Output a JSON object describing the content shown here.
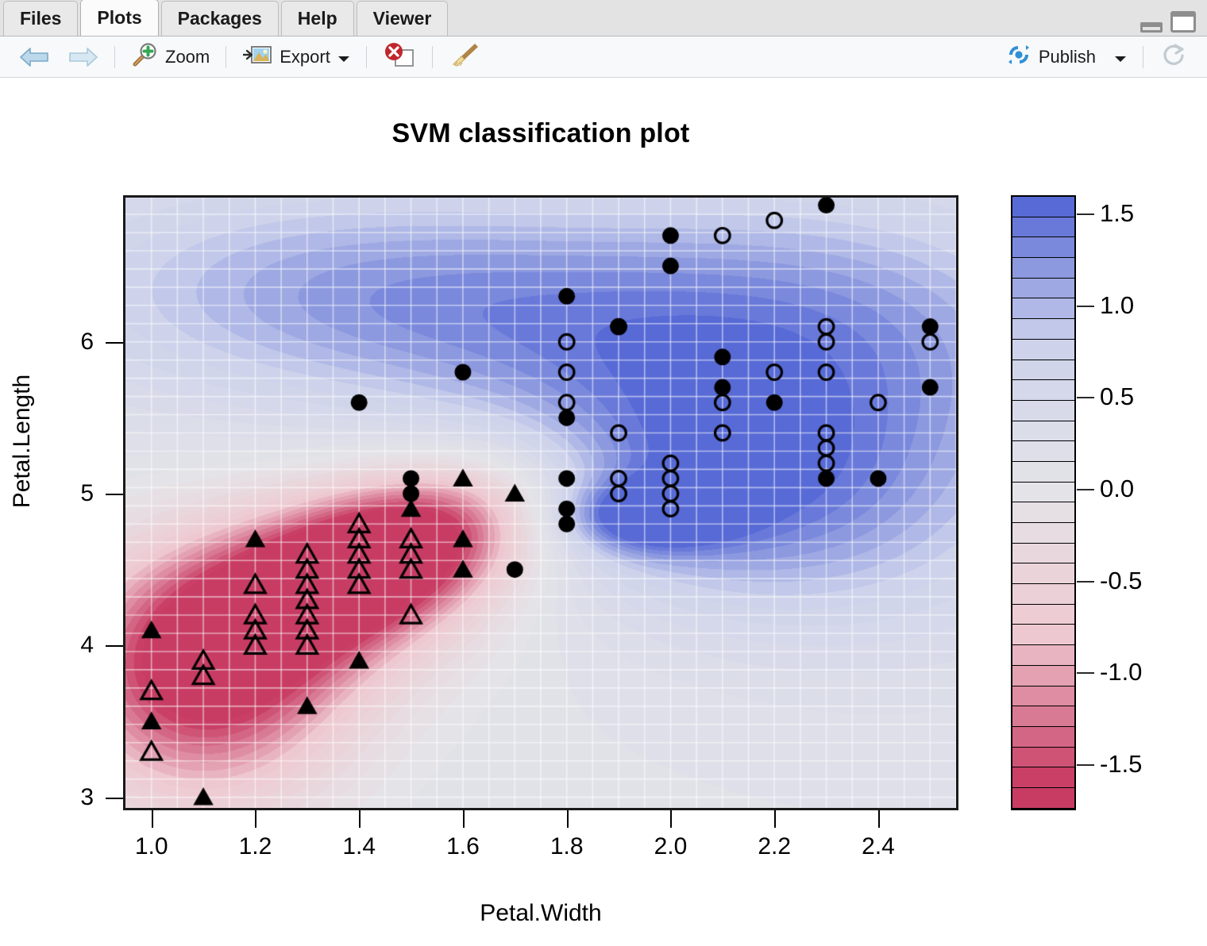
{
  "tabs": [
    {
      "label": "Files"
    },
    {
      "label": "Plots"
    },
    {
      "label": "Packages"
    },
    {
      "label": "Help"
    },
    {
      "label": "Viewer"
    }
  ],
  "active_tab": "Plots",
  "toolbar": {
    "zoom_label": "Zoom",
    "export_label": "Export",
    "publish_label": "Publish",
    "icons": [
      "arrow-left-icon",
      "arrow-right-icon",
      "zoom-icon",
      "export-icon",
      "chevron-down-icon",
      "remove-plot-icon",
      "broom-icon",
      "publish-icon",
      "refresh-icon"
    ]
  },
  "window_controls": {
    "minimize": "minimize-icon",
    "maximize": "maximize-icon"
  },
  "chart_data": {
    "type": "scatter",
    "title": "SVM classification plot",
    "xlabel": "Petal.Width",
    "ylabel": "Petal.Length",
    "xlim": [
      0.95,
      2.55
    ],
    "ylim": [
      2.93,
      6.95
    ],
    "xticks": [
      1.0,
      1.2,
      1.4,
      1.6,
      1.8,
      2.0,
      2.2,
      2.4
    ],
    "xticklabels": [
      "1.0",
      "1.2",
      "1.4",
      "1.6",
      "1.8",
      "2.0",
      "2.2",
      "2.4"
    ],
    "yticks": [
      3,
      4,
      5,
      6
    ],
    "yticklabels": [
      "3",
      "4",
      "5",
      "6"
    ],
    "grid": true,
    "legend": {
      "position": "right",
      "orientation": "vertical",
      "ticks": [
        1.5,
        1.0,
        0.5,
        0.0,
        -0.5,
        -1.0,
        -1.5
      ],
      "ticklabels": [
        "1.5",
        "1.0",
        "0.5",
        "0.0",
        "-0.5",
        "-1.0",
        "-1.5"
      ],
      "range": [
        -1.75,
        1.6
      ],
      "n_bands": 30,
      "colors": {
        "high": "#5c73d4",
        "mid": "#e2e2e6",
        "low": "#c8476f"
      }
    },
    "surface": {
      "description": "SVM decision value contour field: red/negative lobe lower-left, blue/positive lobe upper-right with deep blue core near (1.95, 4.85)",
      "red_peak": {
        "x": 1.46,
        "y": 4.62,
        "value": -1.6
      },
      "red_peak_secondary": {
        "x": 1.1,
        "y": 3.75,
        "value": -1.15
      },
      "blue_peak": {
        "x": 1.95,
        "y": 4.85,
        "value": 1.45
      },
      "blue_ridge": {
        "x": 1.55,
        "y": 6.25,
        "value": 0.9
      }
    },
    "series": [
      {
        "name": "versicolor (filled triangle = support vector)",
        "marker": "filled-triangle",
        "points": [
          [
            1.0,
            4.1
          ],
          [
            1.0,
            3.5
          ],
          [
            1.1,
            3.0
          ],
          [
            1.2,
            4.7
          ],
          [
            1.3,
            3.6
          ],
          [
            1.4,
            3.9
          ],
          [
            1.5,
            4.9
          ],
          [
            1.6,
            5.1
          ],
          [
            1.6,
            4.7
          ],
          [
            1.6,
            4.5
          ],
          [
            1.7,
            5.0
          ]
        ]
      },
      {
        "name": "versicolor (open triangle)",
        "marker": "open-triangle",
        "points": [
          [
            1.0,
            3.7
          ],
          [
            1.0,
            3.3
          ],
          [
            1.1,
            3.9
          ],
          [
            1.1,
            3.8
          ],
          [
            1.2,
            4.4
          ],
          [
            1.2,
            4.2
          ],
          [
            1.2,
            4.1
          ],
          [
            1.2,
            4.0
          ],
          [
            1.3,
            4.6
          ],
          [
            1.3,
            4.5
          ],
          [
            1.3,
            4.4
          ],
          [
            1.3,
            4.3
          ],
          [
            1.3,
            4.2
          ],
          [
            1.3,
            4.1
          ],
          [
            1.3,
            4.0
          ],
          [
            1.4,
            4.8
          ],
          [
            1.4,
            4.7
          ],
          [
            1.4,
            4.6
          ],
          [
            1.4,
            4.5
          ],
          [
            1.4,
            4.4
          ],
          [
            1.5,
            4.7
          ],
          [
            1.5,
            4.6
          ],
          [
            1.5,
            4.5
          ],
          [
            1.5,
            4.2
          ]
        ]
      },
      {
        "name": "virginica (filled circle = support vector)",
        "marker": "filled-circle",
        "points": [
          [
            1.4,
            5.6
          ],
          [
            1.6,
            5.8
          ],
          [
            1.5,
            5.1
          ],
          [
            1.5,
            5.0
          ],
          [
            1.7,
            4.5
          ],
          [
            1.8,
            6.3
          ],
          [
            1.8,
            5.5
          ],
          [
            1.8,
            5.1
          ],
          [
            1.8,
            4.9
          ],
          [
            1.8,
            4.8
          ],
          [
            1.9,
            6.1
          ],
          [
            2.0,
            6.7
          ],
          [
            2.0,
            6.5
          ],
          [
            2.1,
            5.9
          ],
          [
            2.1,
            5.7
          ],
          [
            2.2,
            5.6
          ],
          [
            2.3,
            6.9
          ],
          [
            2.3,
            5.1
          ],
          [
            2.4,
            5.1
          ],
          [
            2.5,
            6.1
          ],
          [
            2.5,
            5.7
          ]
        ]
      },
      {
        "name": "virginica (open circle)",
        "marker": "open-circle",
        "points": [
          [
            1.8,
            6.0
          ],
          [
            1.8,
            5.8
          ],
          [
            1.8,
            5.6
          ],
          [
            1.9,
            5.4
          ],
          [
            1.9,
            5.1
          ],
          [
            1.9,
            5.0
          ],
          [
            2.0,
            5.2
          ],
          [
            2.0,
            5.1
          ],
          [
            2.0,
            5.0
          ],
          [
            2.0,
            4.9
          ],
          [
            2.1,
            6.7
          ],
          [
            2.1,
            5.6
          ],
          [
            2.1,
            5.4
          ],
          [
            2.2,
            6.8
          ],
          [
            2.2,
            5.8
          ],
          [
            2.3,
            6.1
          ],
          [
            2.3,
            6.0
          ],
          [
            2.3,
            5.8
          ],
          [
            2.3,
            5.4
          ],
          [
            2.3,
            5.3
          ],
          [
            2.3,
            5.2
          ],
          [
            2.4,
            5.6
          ],
          [
            2.5,
            6.0
          ],
          [
            1.9,
            6.1
          ]
        ]
      }
    ]
  }
}
